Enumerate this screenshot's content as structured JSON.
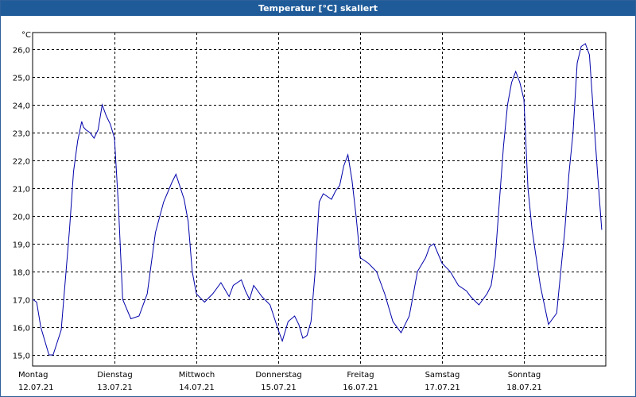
{
  "window": {
    "title": "Temperatur [°C] skaliert"
  },
  "colors": {
    "title_bar": "#1f5b99",
    "line": "#0000aa",
    "grid": "#000000",
    "background": "#ffffff"
  },
  "chart_data": {
    "type": "line",
    "title": "Temperatur [°C] skaliert",
    "ylabel": "°C",
    "xlabel": "",
    "ylim": [
      14.6,
      26.6
    ],
    "xlim": [
      0,
      7
    ],
    "grid": true,
    "yticks": [
      "15,0",
      "16,0",
      "17,0",
      "18,0",
      "19,0",
      "20,0",
      "21,0",
      "22,0",
      "23,0",
      "24,0",
      "25,0",
      "26,0"
    ],
    "yticks_values": [
      15,
      16,
      17,
      18,
      19,
      20,
      21,
      22,
      23,
      24,
      25,
      26
    ],
    "xticks": [
      {
        "day": "Montag",
        "date": "12.07.21"
      },
      {
        "day": "Dienstag",
        "date": "13.07.21"
      },
      {
        "day": "Mittwoch",
        "date": "14.07.21"
      },
      {
        "day": "Donnerstag",
        "date": "15.07.21"
      },
      {
        "day": "Freitag",
        "date": "16.07.21"
      },
      {
        "day": "Samstag",
        "date": "17.07.21"
      },
      {
        "day": "Sonntag",
        "date": "18.07.21"
      }
    ],
    "series": [
      {
        "x": [
          0.0,
          0.05,
          0.1,
          0.2,
          0.25,
          0.35,
          0.45,
          0.5,
          0.55,
          0.6,
          0.62,
          0.65,
          0.7,
          0.75,
          0.8,
          0.85,
          0.9,
          0.95,
          1.0,
          1.05,
          1.1,
          1.2,
          1.3,
          1.4,
          1.5,
          1.6,
          1.7,
          1.75,
          1.85,
          1.9,
          1.95,
          2.0,
          2.1,
          2.2,
          2.3,
          2.4,
          2.45,
          2.55,
          2.6,
          2.65,
          2.7,
          2.75,
          2.8,
          2.9,
          3.0,
          3.05,
          3.12,
          3.2,
          3.25,
          3.3,
          3.35,
          3.4,
          3.45,
          3.5,
          3.55,
          3.6,
          3.65,
          3.7,
          3.75,
          3.8,
          3.85,
          3.9,
          3.95,
          4.0,
          4.1,
          4.2,
          4.3,
          4.4,
          4.5,
          4.6,
          4.65,
          4.7,
          4.8,
          4.85,
          4.9,
          5.0,
          5.1,
          5.2,
          5.3,
          5.35,
          5.45,
          5.5,
          5.55,
          5.6,
          5.65,
          5.7,
          5.75,
          5.8,
          5.85,
          5.9,
          5.95,
          6.0,
          6.05,
          6.1,
          6.2,
          6.3,
          6.4,
          6.5,
          6.55,
          6.6,
          6.65,
          6.7,
          6.75,
          6.8,
          6.9,
          6.95
        ],
        "values": [
          17.0,
          16.9,
          16.0,
          15.0,
          15.0,
          15.9,
          19.5,
          21.6,
          22.7,
          23.4,
          23.2,
          23.1,
          23.0,
          22.8,
          23.1,
          24.0,
          23.6,
          23.3,
          22.8,
          20.3,
          17.0,
          16.3,
          16.4,
          17.2,
          19.4,
          20.5,
          21.2,
          21.5,
          20.6,
          19.8,
          18.0,
          17.2,
          16.9,
          17.2,
          17.6,
          17.1,
          17.5,
          17.7,
          17.3,
          17.0,
          17.5,
          17.3,
          17.1,
          16.8,
          15.9,
          15.5,
          16.2,
          16.4,
          16.1,
          15.6,
          15.7,
          16.2,
          18.0,
          20.5,
          20.8,
          20.7,
          20.6,
          20.9,
          21.1,
          21.8,
          22.2,
          21.3,
          20.0,
          18.5,
          18.3,
          18.0,
          17.2,
          16.2,
          15.8,
          16.4,
          17.2,
          18.0,
          18.5,
          18.9,
          19.0,
          18.3,
          18.0,
          17.5,
          17.3,
          17.1,
          16.8,
          17.0,
          17.2,
          17.5,
          18.5,
          20.5,
          22.5,
          24.0,
          24.8,
          25.2,
          24.8,
          24.2,
          21.0,
          19.5,
          17.5,
          16.1,
          16.5,
          19.5,
          21.5,
          23.0,
          25.5,
          26.1,
          26.2,
          25.8,
          21.5,
          19.5
        ]
      }
    ]
  }
}
